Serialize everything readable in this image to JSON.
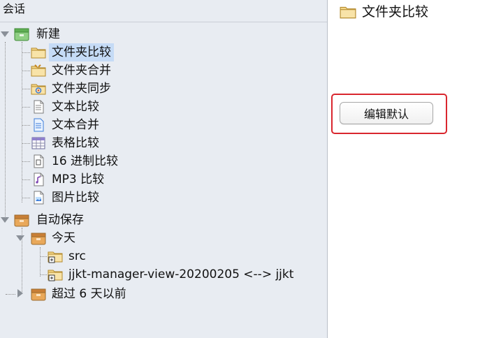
{
  "left_panel": {
    "header": "会话"
  },
  "tree": {
    "new_group": {
      "label": "新建",
      "items": [
        {
          "label": "文件夹比较",
          "icon": "folder-icon",
          "selected": true
        },
        {
          "label": "文件夹合并",
          "icon": "folder-merge-icon"
        },
        {
          "label": "文件夹同步",
          "icon": "folder-sync-icon"
        },
        {
          "label": "文本比较",
          "icon": "text-doc-icon"
        },
        {
          "label": "文本合并",
          "icon": "text-merge-icon"
        },
        {
          "label": "表格比较",
          "icon": "table-icon"
        },
        {
          "label": "16 进制比较",
          "icon": "hex-doc-icon"
        },
        {
          "label": "MP3 比较",
          "icon": "mp3-doc-icon"
        },
        {
          "label": "图片比较",
          "icon": "image-doc-icon"
        }
      ]
    },
    "autosave_group": {
      "label": "自动保存",
      "today": {
        "label": "今天",
        "items": [
          {
            "label": "src",
            "icon": "folder-session-icon"
          },
          {
            "label": "jjkt-manager-view-20200205 <--> jjkt",
            "icon": "folder-session-icon"
          }
        ]
      },
      "older": {
        "label": "超过 6 天以前"
      }
    }
  },
  "right_panel": {
    "title": "文件夹比较",
    "title_icon": "folder-icon",
    "edit_default_button": "编辑默认"
  },
  "colors": {
    "sidebar_bg": "#e8ecf2",
    "selection": "#c5dbf6",
    "highlight_border": "#d9262e",
    "folder": "#f3c96d"
  }
}
